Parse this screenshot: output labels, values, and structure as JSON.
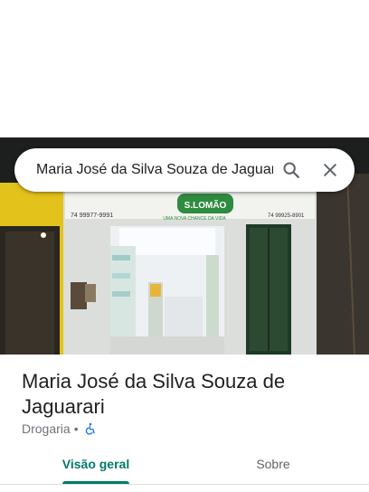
{
  "search": {
    "query": "Maria José da Silva Souza de Jaguarari",
    "search_icon": "search-icon",
    "close_icon": "close-icon"
  },
  "photo": {
    "sign_text": "S.LOMÃO",
    "sign_slogan": "UMA NOVA CHANCE DA VIDA",
    "phone_left": "74 99977-9991",
    "phone_right": "74 99925-8901"
  },
  "place": {
    "title": "Maria José da Silva Souza de Jaguarari",
    "category": "Drogaria",
    "separator": "•",
    "accessibility_icon": "wheelchair-icon"
  },
  "tabs": [
    {
      "label": "Visão geral",
      "active": true
    },
    {
      "label": "Sobre",
      "active": false
    }
  ],
  "colors": {
    "accent": "#00796b",
    "title_text": "#202124",
    "secondary_text": "#70757a",
    "accessibility_icon": "#1a73e8"
  }
}
